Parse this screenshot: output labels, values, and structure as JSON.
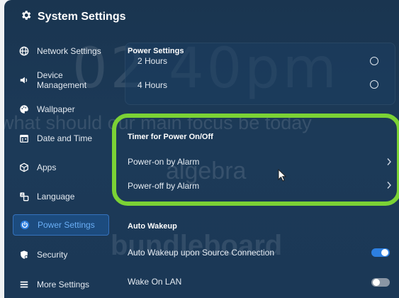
{
  "window": {
    "title": "System Settings",
    "title_icon": "gear-icon"
  },
  "background": {
    "clock_text": "02 40pm",
    "line1": "what should our main focus be today",
    "line2": "algebra",
    "brand": "bundleboard"
  },
  "sidebar": {
    "items": [
      {
        "label": "Network Settings",
        "icon": "globe-icon"
      },
      {
        "label": "Device Management",
        "icon": "speaker-icon"
      },
      {
        "label": "Wallpaper",
        "icon": "palette-icon"
      },
      {
        "label": "Date and Time",
        "icon": "calendar-icon"
      },
      {
        "label": "Apps",
        "icon": "cube-icon"
      },
      {
        "label": "Language",
        "icon": "language-icon"
      },
      {
        "label": "Power Settings",
        "icon": "power-icon",
        "active": true
      },
      {
        "label": "Security",
        "icon": "shield-icon"
      },
      {
        "label": "More Settings",
        "icon": "menu-icon"
      }
    ]
  },
  "main": {
    "power_settings": {
      "heading": "Power Settings",
      "options": [
        {
          "label": "2 Hours",
          "selected": false
        },
        {
          "label": "4 Hours",
          "selected": false
        }
      ]
    },
    "timer": {
      "heading": "Timer for Power On/Off",
      "items": [
        {
          "label": "Power-on by Alarm"
        },
        {
          "label": "Power-off by Alarm"
        }
      ]
    },
    "auto_wakeup": {
      "heading": "Auto Wakeup",
      "items": [
        {
          "label": "Auto Wakeup upon Source Connection",
          "enabled": true
        },
        {
          "label": "Wake On LAN",
          "enabled": false
        }
      ]
    }
  },
  "colors": {
    "panel": "#1b3856",
    "accent": "#2d7fe0",
    "highlight": "#7bd235"
  }
}
